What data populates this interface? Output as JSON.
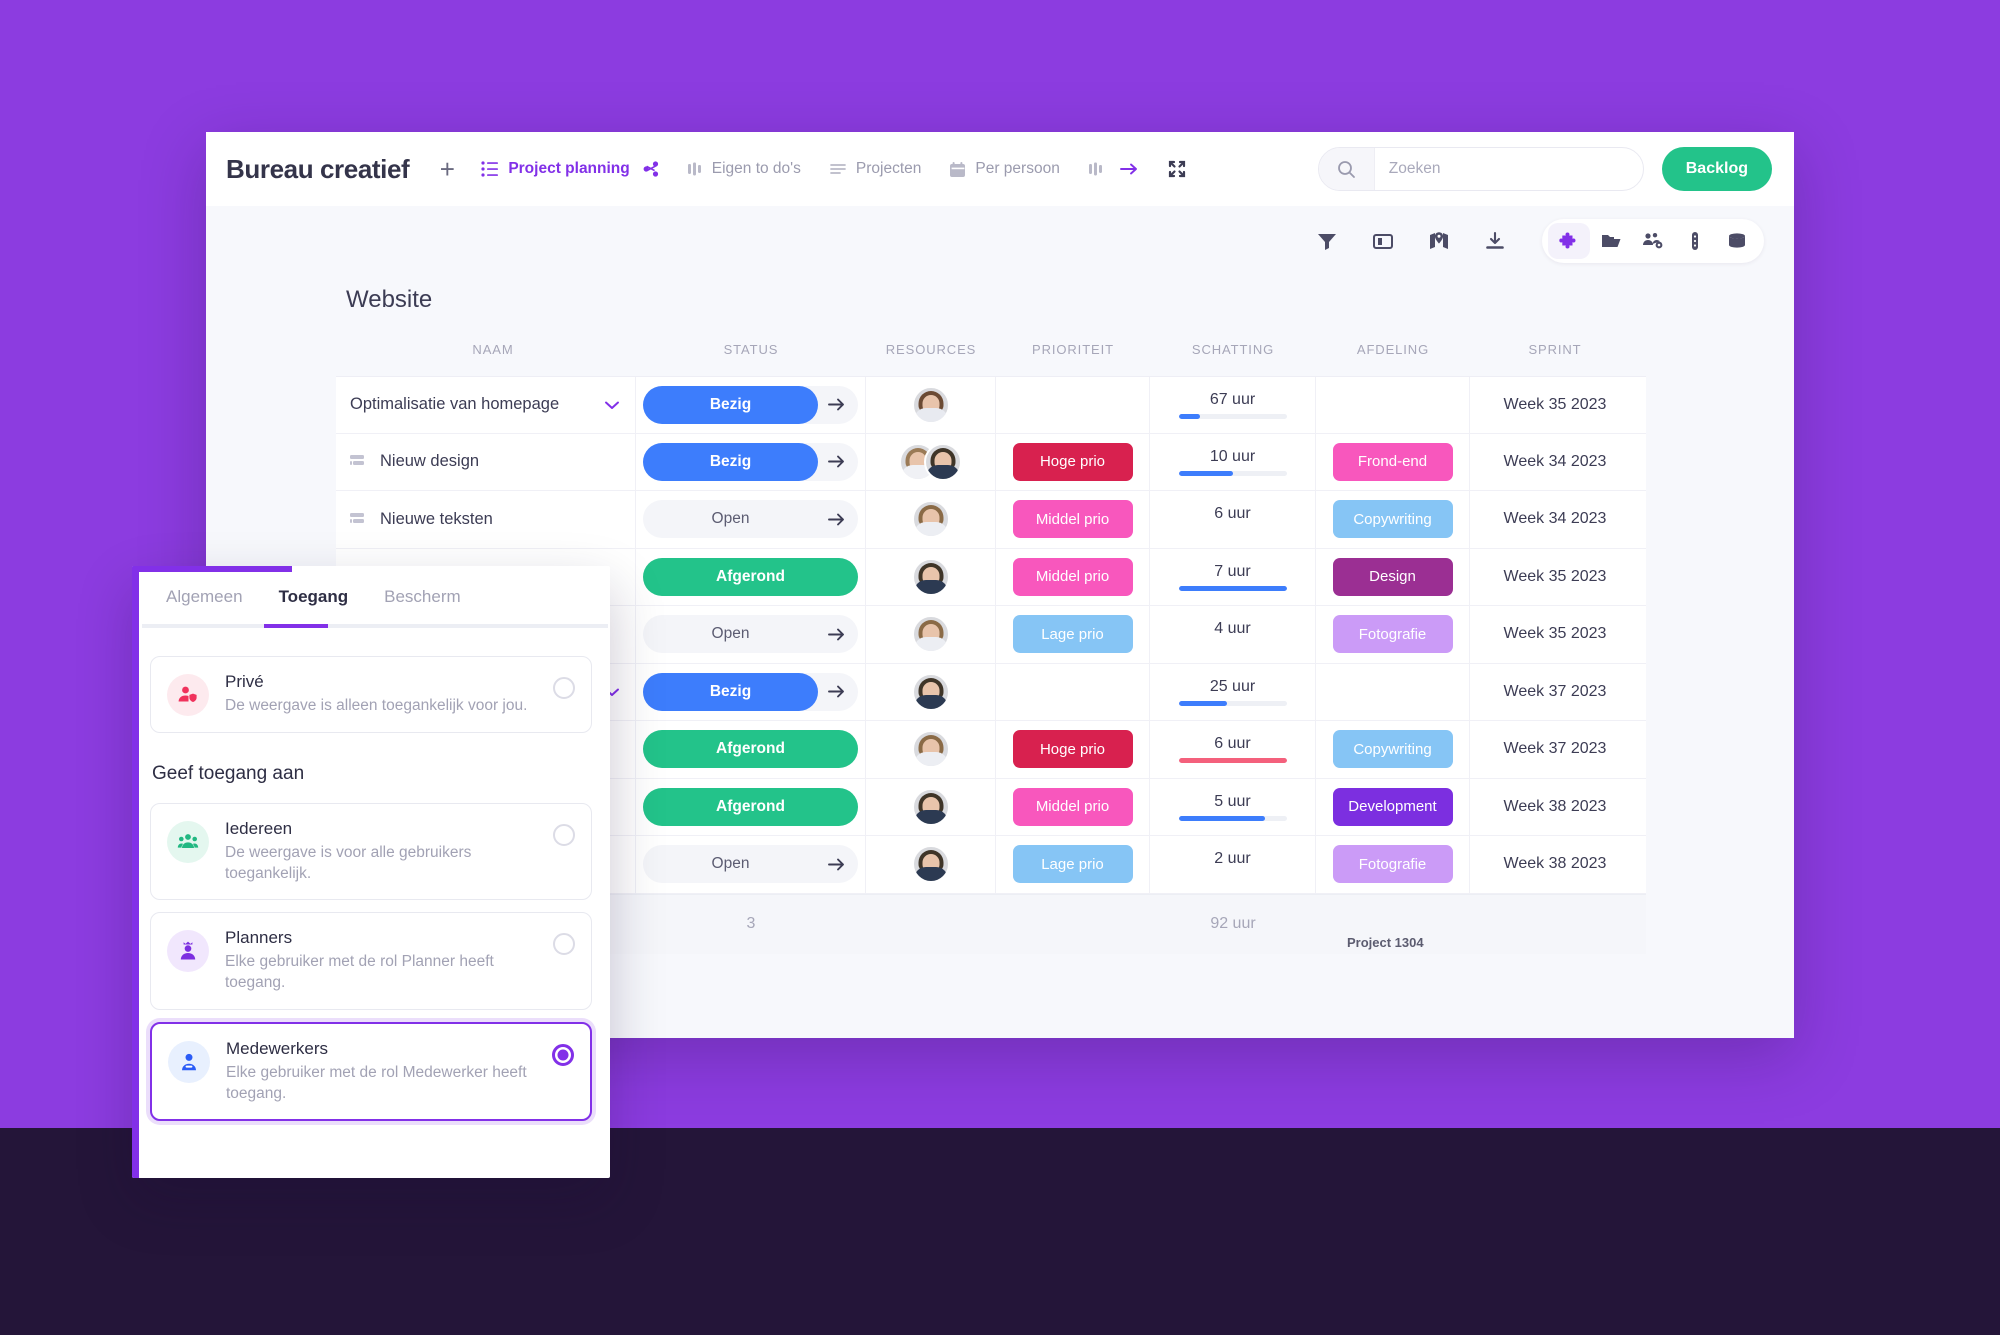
{
  "window": {
    "brand": "Bureau creatief",
    "add_label": "+",
    "nav": [
      {
        "label": "Project planning",
        "icon": "list-icon",
        "active": true,
        "share": true
      },
      {
        "label": "Eigen to do's",
        "icon": "columns-icon",
        "active": false
      },
      {
        "label": "Projecten",
        "icon": "menu-lines-icon",
        "active": false
      },
      {
        "label": "Per persoon",
        "icon": "calendar-icon",
        "active": false
      },
      {
        "label": "",
        "icon": "columns-arrow-icon",
        "active": false
      },
      {
        "label": "",
        "icon": "expand-icon",
        "active": false
      }
    ],
    "search": {
      "value": "",
      "placeholder": "Zoeken",
      "icon": "search-icon"
    },
    "backlog_label": "Backlog"
  },
  "toolbar": {
    "left_icons": [
      "filter-icon",
      "split-view-icon",
      "map-icon",
      "download-icon"
    ],
    "pill_icons": [
      "puzzle-icon",
      "folder-icon",
      "users-gear-icon",
      "battery-icon",
      "archive-icon"
    ],
    "active_pill_icon": "puzzle-icon",
    "accent": "#8230e8"
  },
  "board": {
    "title": "Website",
    "columns": [
      "NAAM",
      "STATUS",
      "RESOURCES",
      "PRIORITEIT",
      "SCHATTING",
      "AFDELING",
      "SPRINT"
    ],
    "rows": [
      {
        "name": "Optimalisatie van homepage",
        "is_subtask": false,
        "has_chevron": true,
        "status": "Bezig",
        "status_color": "#3d7dfc",
        "status_arrow": true,
        "avatars": [
          {
            "hair": "#6b4a33",
            "body": "#e8eaf0"
          }
        ],
        "priority": "",
        "priority_color": "",
        "estimate": "67 uur",
        "estimate_pct": 20,
        "estimate_bar_color": "#3d7dfc",
        "has_bar": true,
        "department": "",
        "department_color": "",
        "sprint": "Week 35 2023"
      },
      {
        "name": "Nieuw design",
        "is_subtask": true,
        "has_chevron": false,
        "status": "Bezig",
        "status_color": "#3d7dfc",
        "status_arrow": true,
        "avatars": [
          {
            "hair": "#9a7a56",
            "body": "#f0f1f5"
          },
          {
            "hair": "#3f3528",
            "body": "#2c3a52"
          }
        ],
        "priority": "Hoge prio",
        "priority_color": "#d8214f",
        "estimate": "10 uur",
        "estimate_pct": 50,
        "estimate_bar_color": "#3d7dfc",
        "has_bar": true,
        "department": "Frond-end",
        "department_color": "#f857bd",
        "sprint": "Week 34 2023"
      },
      {
        "name": "Nieuwe teksten",
        "is_subtask": true,
        "has_chevron": false,
        "status": "Open",
        "status_color": "",
        "status_arrow": true,
        "avatars": [
          {
            "hair": "#8a6a46",
            "body": "#eceef3"
          }
        ],
        "priority": "Middel prio",
        "priority_color": "#f857bd",
        "estimate": "6 uur",
        "estimate_pct": 0,
        "estimate_bar_color": "#3d7dfc",
        "has_bar": false,
        "department": "Copywriting",
        "department_color": "#86c5f5",
        "sprint": "Week 34 2023"
      },
      {
        "name": "",
        "is_subtask": true,
        "has_chevron": false,
        "status": "Afgerond",
        "status_color": "#23c38a",
        "status_arrow": false,
        "avatars": [
          {
            "hair": "#3f3528",
            "body": "#2c3a52"
          }
        ],
        "priority": "Middel prio",
        "priority_color": "#f857bd",
        "estimate": "7 uur",
        "estimate_pct": 100,
        "estimate_bar_color": "#3d7dfc",
        "has_bar": true,
        "department": "Design",
        "department_color": "#9b2f93",
        "sprint": "Week 35 2023"
      },
      {
        "name": "",
        "is_subtask": true,
        "has_chevron": false,
        "status": "Open",
        "status_color": "",
        "status_arrow": true,
        "avatars": [
          {
            "hair": "#8a6a46",
            "body": "#eceef3"
          }
        ],
        "priority": "Lage prio",
        "priority_color": "#86c5f5",
        "estimate": "4 uur",
        "estimate_pct": 0,
        "estimate_bar_color": "#3d7dfc",
        "has_bar": false,
        "department": "Fotografie",
        "department_color": "#cb9bf7",
        "sprint": "Week 35 2023"
      },
      {
        "name": "",
        "is_subtask": false,
        "has_chevron": true,
        "status": "Bezig",
        "status_color": "#3d7dfc",
        "status_arrow": true,
        "avatars": [
          {
            "hair": "#3f3528",
            "body": "#2c3a52"
          }
        ],
        "priority": "",
        "priority_color": "",
        "estimate": "25 uur",
        "estimate_pct": 45,
        "estimate_bar_color": "#3d7dfc",
        "has_bar": true,
        "department": "",
        "department_color": "",
        "sprint": "Week 37 2023"
      },
      {
        "name": "",
        "is_subtask": true,
        "has_chevron": false,
        "status": "Afgerond",
        "status_color": "#23c38a",
        "status_arrow": false,
        "avatars": [
          {
            "hair": "#8a6a46",
            "body": "#eceef3"
          }
        ],
        "priority": "Hoge prio",
        "priority_color": "#d8214f",
        "estimate": "6 uur",
        "estimate_pct": 100,
        "estimate_bar_color": "#f4607c",
        "has_bar": true,
        "department": "Copywriting",
        "department_color": "#86c5f5",
        "sprint": "Week 37 2023"
      },
      {
        "name": "",
        "is_subtask": true,
        "has_chevron": false,
        "status": "Afgerond",
        "status_color": "#23c38a",
        "status_arrow": false,
        "avatars": [
          {
            "hair": "#3f3528",
            "body": "#2c3a52"
          }
        ],
        "priority": "Middel prio",
        "priority_color": "#f857bd",
        "estimate": "5 uur",
        "estimate_pct": 80,
        "estimate_bar_color": "#3d7dfc",
        "has_bar": true,
        "department": "Development",
        "department_color": "#7c2fe0",
        "sprint": "Week 38 2023"
      },
      {
        "name": "",
        "is_subtask": true,
        "has_chevron": false,
        "status": "Open",
        "status_color": "",
        "status_arrow": true,
        "avatars": [
          {
            "hair": "#3f3528",
            "body": "#2c3a52"
          }
        ],
        "priority": "Lage prio",
        "priority_color": "#86c5f5",
        "estimate": "2 uur",
        "estimate_pct": 0,
        "estimate_bar_color": "#3d7dfc",
        "has_bar": false,
        "department": "Fotografie",
        "department_color": "#cb9bf7",
        "sprint": "Week 38 2023"
      }
    ],
    "footer": {
      "status_total": "3",
      "estimate_total": "92 uur"
    },
    "tooltip": "Project 1304"
  },
  "dialog": {
    "tabs": [
      {
        "label": "Algemeen",
        "active": false
      },
      {
        "label": "Toegang",
        "active": true
      },
      {
        "label": "Bescherm",
        "active": false
      }
    ],
    "private_option": {
      "title": "Privé",
      "desc": "De weergave is alleen toegankelijk voor jou.",
      "icon": "user-shield-icon",
      "icon_color": "#f0325c",
      "icon_bg": "#fdeaee",
      "selected": false
    },
    "section_label": "Geef toegang aan",
    "options": [
      {
        "title": "Iedereen",
        "desc": "De weergave is voor alle gebruikers toegankelijk.",
        "icon": "users-group-icon",
        "icon_color": "#22b882",
        "icon_bg": "#e4f7ef",
        "selected": false
      },
      {
        "title": "Planners",
        "desc": "Elke gebruiker met de rol Planner heeft toegang.",
        "icon": "user-crown-icon",
        "icon_color": "#7c2fe0",
        "icon_bg": "#f1e7fd",
        "selected": false
      },
      {
        "title": "Medewerkers",
        "desc": "Elke gebruiker met de rol Medewerker heeft toegang.",
        "icon": "user-badge-icon",
        "icon_color": "#2b5cf6",
        "icon_bg": "#e8f0fe",
        "selected": true
      }
    ]
  },
  "background": {
    "top_band": "#8c3ce0",
    "bottom_band": "#241539"
  }
}
